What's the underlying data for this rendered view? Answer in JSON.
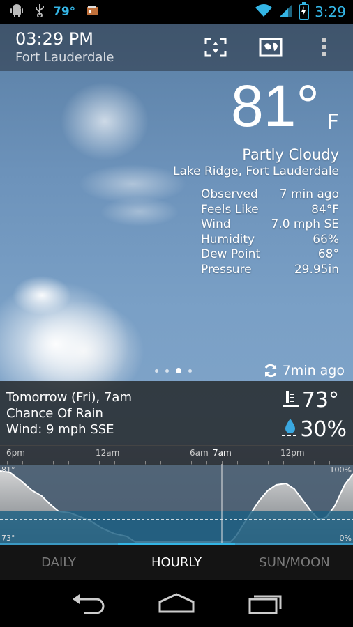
{
  "status_bar": {
    "temperature": "79°",
    "time": "3:29",
    "icons": [
      "android-icon",
      "usb-icon",
      "weather-app-icon",
      "wifi-icon",
      "signal-icon",
      "battery-charging-icon"
    ]
  },
  "header": {
    "time": "03:29 PM",
    "city": "Fort Lauderdale",
    "actions": [
      "fullscreen-icon",
      "map-icon",
      "overflow-menu-icon"
    ]
  },
  "current": {
    "temperature": "81",
    "degree_symbol": "°",
    "unit": "F",
    "condition": "Partly Cloudy",
    "station": "Lake Ridge, Fort Lauderdale",
    "details": [
      {
        "label": "Observed",
        "value": "7 min ago"
      },
      {
        "label": "Feels Like",
        "value": "84°F"
      },
      {
        "label": "Wind",
        "value": "7.0 mph SE"
      },
      {
        "label": "Humidity",
        "value": "66%"
      },
      {
        "label": "Dew Point",
        "value": "68°"
      },
      {
        "label": "Pressure",
        "value": "29.95in"
      }
    ],
    "pages": 4,
    "active_page": 3,
    "updated": "7min ago"
  },
  "forecast": {
    "when": "Tomorrow (Fri), 7am",
    "summary": "Chance Of Rain",
    "wind": "Wind: 9 mph SSE",
    "temperature": "73°",
    "precip_chance": "30%"
  },
  "hourly": {
    "time_labels": [
      "6pm",
      "12am",
      "6am",
      "7am",
      "12pm"
    ],
    "selected": "7am",
    "temp_max_label": "81°",
    "temp_min_label": "73°",
    "pop_max_label": "100%",
    "pop_min_label": "0%"
  },
  "tabs": {
    "items": [
      "DAILY",
      "HOURLY",
      "SUN/MOON"
    ],
    "active": "HOURLY"
  },
  "nav": [
    "back-icon",
    "home-icon",
    "recent-apps-icon"
  ],
  "colors": {
    "accent": "#33b5e5",
    "sky": "#7aa0c6",
    "chart_water": "#1b5f82"
  }
}
